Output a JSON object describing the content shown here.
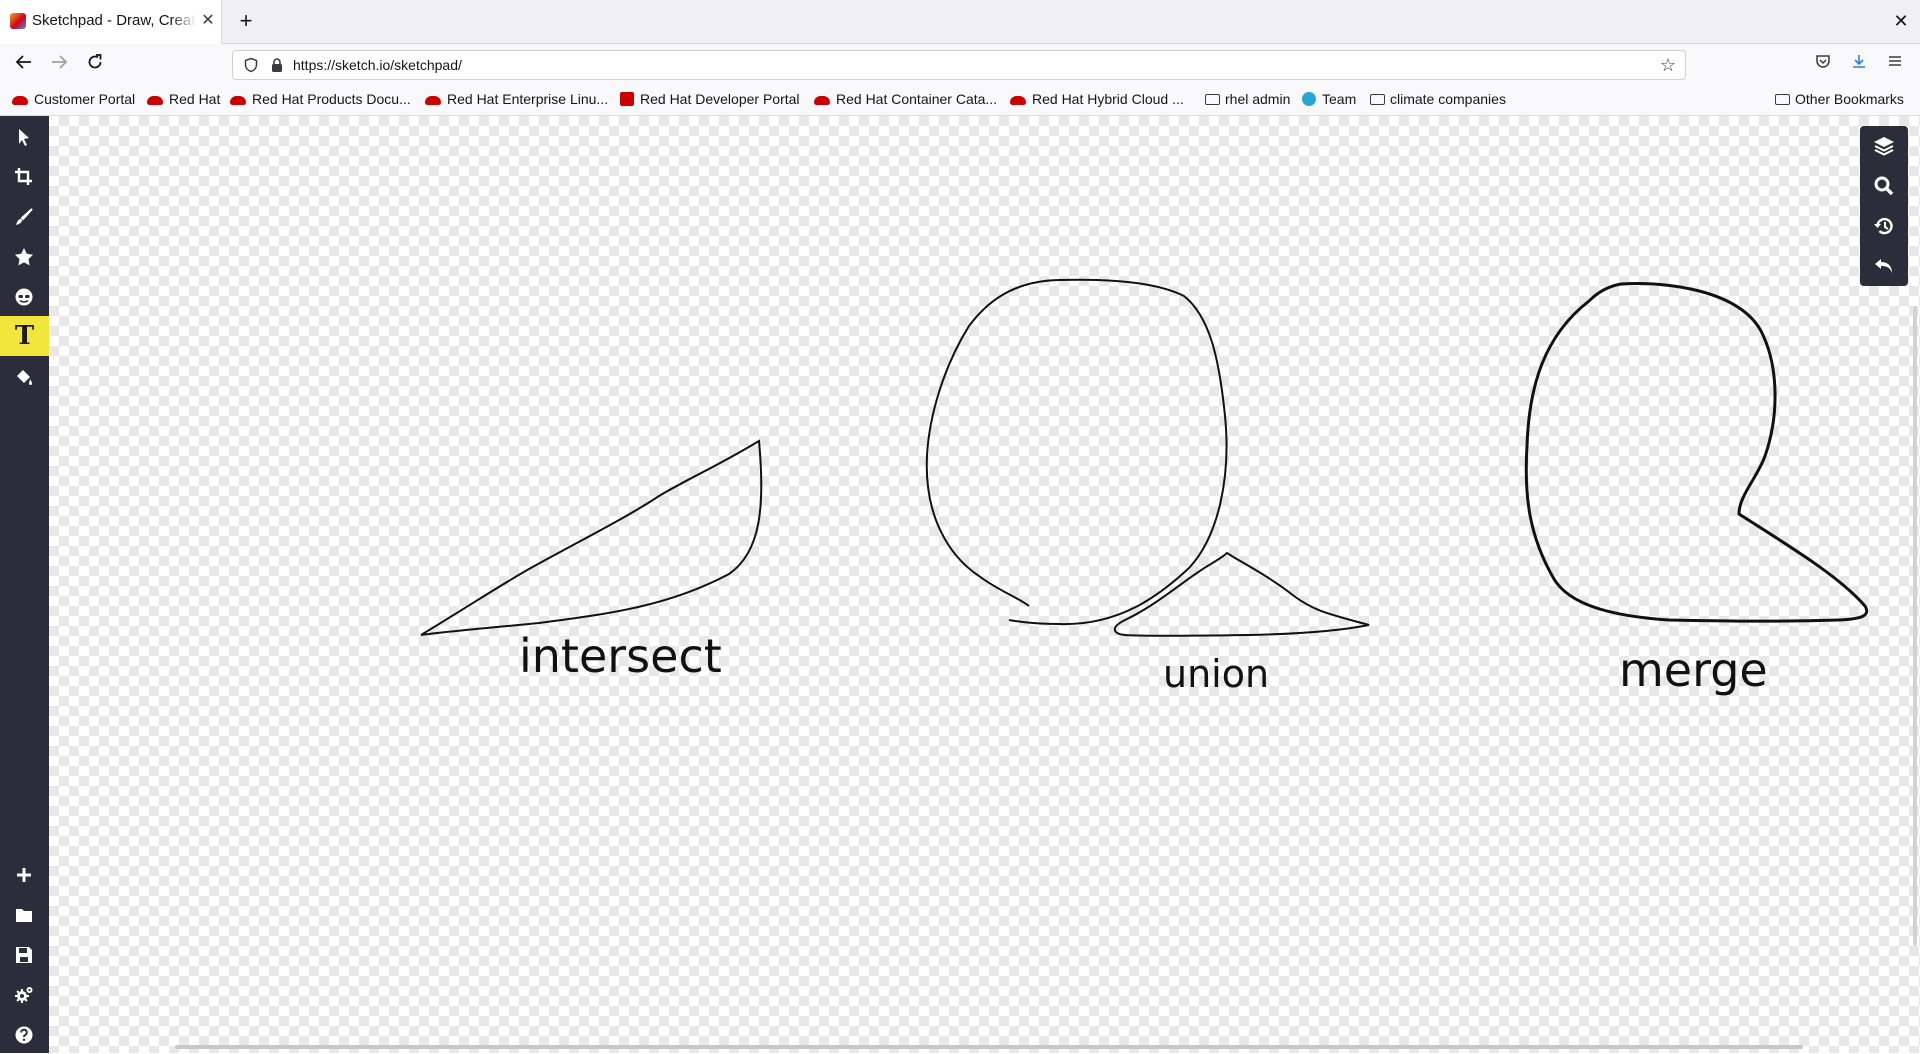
{
  "browser": {
    "tab_title": "Sketchpad - Draw, Create",
    "tab_close": "✕",
    "new_tab": "+",
    "window_close": "✕",
    "url": "https://sketch.io/sketchpad/",
    "bookmarks": [
      {
        "label": "Customer Portal",
        "icon": "redhat-icon"
      },
      {
        "label": "Red Hat",
        "icon": "redhat-icon"
      },
      {
        "label": "Red Hat Products Docu...",
        "icon": "redhat-icon"
      },
      {
        "label": "Red Hat Enterprise Linu...",
        "icon": "redhat-icon"
      },
      {
        "label": "Red Hat Developer Portal",
        "icon": "redhat-square-icon"
      },
      {
        "label": "Red Hat Container Cata...",
        "icon": "redhat-icon"
      },
      {
        "label": "Red Hat Hybrid Cloud ...",
        "icon": "redhat-icon"
      },
      {
        "label": "rhel admin",
        "icon": "folder-icon"
      },
      {
        "label": "Team",
        "icon": "team-icon"
      },
      {
        "label": "climate companies",
        "icon": "folder-icon"
      }
    ],
    "other_bookmarks": "Other Bookmarks"
  },
  "toolbar_left": {
    "tools": [
      "select-tool",
      "crop-tool",
      "brush-tool",
      "stamp-tool",
      "emoji-tool",
      "text-tool",
      "fill-tool"
    ],
    "active_tool": "text-tool",
    "text_tool_glyph": "T",
    "bottom": [
      "new-icon",
      "open-folder-icon",
      "save-icon",
      "settings-icon",
      "help-icon"
    ]
  },
  "toolbar_right": [
    "layers-icon",
    "zoom-icon",
    "history-icon",
    "undo-icon"
  ],
  "canvas": {
    "labels": {
      "intersect": "intersect",
      "union": "union",
      "merge": "merge"
    }
  }
}
